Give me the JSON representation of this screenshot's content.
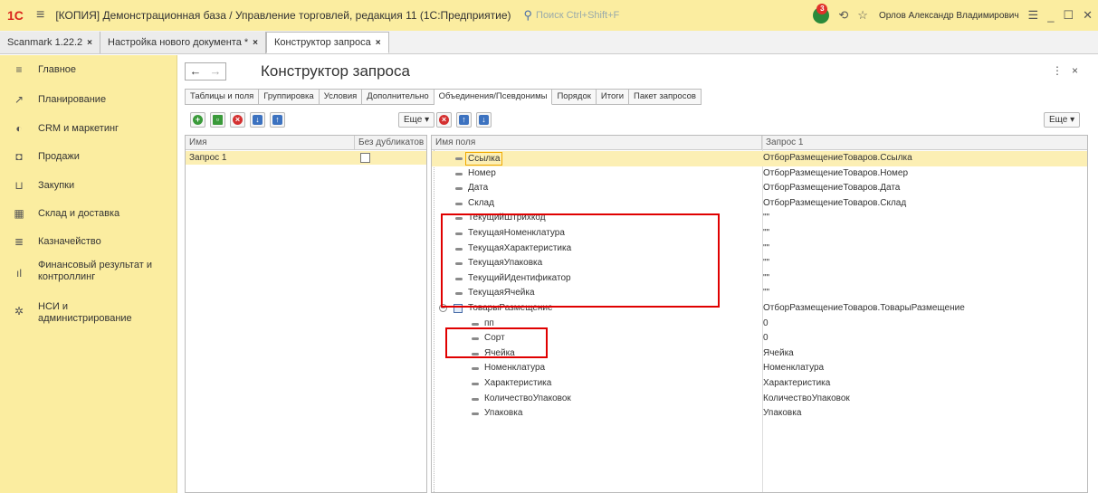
{
  "titlebar": {
    "logo": "1С",
    "title": "[КОПИЯ] Демонстрационная база / Управление торговлей, редакция 11  (1С:Предприятие)",
    "search_placeholder": "Поиск Ctrl+Shift+F",
    "notif_count": "3",
    "user": "Орлов Александр Владимирович"
  },
  "doc_tabs": [
    {
      "label": "Scanmark 1.22.2"
    },
    {
      "label": "Настройка нового документа *"
    },
    {
      "label": "Конструктор запроса"
    }
  ],
  "sidebar": {
    "items": [
      {
        "label": "Главное",
        "icon": "menu-icon"
      },
      {
        "label": "Планирование",
        "icon": "chart-icon"
      },
      {
        "label": "CRM и маркетинг",
        "icon": "crm-icon"
      },
      {
        "label": "Продажи",
        "icon": "bag-icon"
      },
      {
        "label": "Закупки",
        "icon": "cart-icon"
      },
      {
        "label": "Склад и доставка",
        "icon": "warehouse-icon"
      },
      {
        "label": "Казначейство",
        "icon": "coins-icon"
      },
      {
        "label": "Финансовый результат и",
        "label2": "контроллинг",
        "icon": "bar-chart-icon"
      },
      {
        "label": "НСИ и",
        "label2": "администрирование",
        "icon": "gear-icon"
      }
    ]
  },
  "main": {
    "title": "Конструктор запроса",
    "query_tabs": [
      "Таблицы и поля",
      "Группировка",
      "Условия",
      "Дополнительно",
      "Объединения/Псевдонимы",
      "Порядок",
      "Итоги",
      "Пакет запросов"
    ],
    "more_label": "Еще ▾",
    "left_table": {
      "headers": [
        "Имя",
        "Без дубликатов"
      ],
      "rows": [
        {
          "name": "Запрос 1",
          "no_duplicates": false
        }
      ]
    },
    "right_table": {
      "headers": [
        "Имя поля",
        "Запрос 1"
      ],
      "rows": [
        {
          "field": "Ссылка",
          "value": "ОтборРазмещениеТоваров.Ссылка",
          "level": 1,
          "selected": true
        },
        {
          "field": "Номер",
          "value": "ОтборРазмещениеТоваров.Номер",
          "level": 1
        },
        {
          "field": "Дата",
          "value": "ОтборРазмещениеТоваров.Дата",
          "level": 1
        },
        {
          "field": "Склад",
          "value": "ОтборРазмещениеТоваров.Склад",
          "level": 1
        },
        {
          "field": "ТекущийШтрихкод",
          "value": "\"\"",
          "level": 1
        },
        {
          "field": "ТекущаяНоменклатура",
          "value": "\"\"",
          "level": 1
        },
        {
          "field": "ТекущаяХарактеристика",
          "value": "\"\"",
          "level": 1
        },
        {
          "field": "ТекущаяУпаковка",
          "value": "\"\"",
          "level": 1
        },
        {
          "field": "ТекущийИдентификатор",
          "value": "\"\"",
          "level": 1
        },
        {
          "field": "ТекущаяЯчейка",
          "value": "\"\"",
          "level": 1
        },
        {
          "field": "ТоварыРазмещение",
          "value": "ОтборРазмещениеТоваров.ТоварыРазмещение",
          "level": 0,
          "table": true
        },
        {
          "field": "пп",
          "value": "0",
          "level": 2
        },
        {
          "field": "Сорт",
          "value": "0",
          "level": 2
        },
        {
          "field": "Ячейка",
          "value": "Ячейка",
          "level": 2
        },
        {
          "field": "Номенклатура",
          "value": "Номенклатура",
          "level": 2
        },
        {
          "field": "Характеристика",
          "value": "Характеристика",
          "level": 2
        },
        {
          "field": "КоличествоУпаковок",
          "value": "КоличествоУпаковок",
          "level": 2
        },
        {
          "field": "Упаковка",
          "value": "Упаковка",
          "level": 2
        }
      ]
    }
  },
  "colors": {
    "accent_yellow": "#fbeda0",
    "selection": "#fcefb4",
    "highlight_red": "#e00000"
  }
}
